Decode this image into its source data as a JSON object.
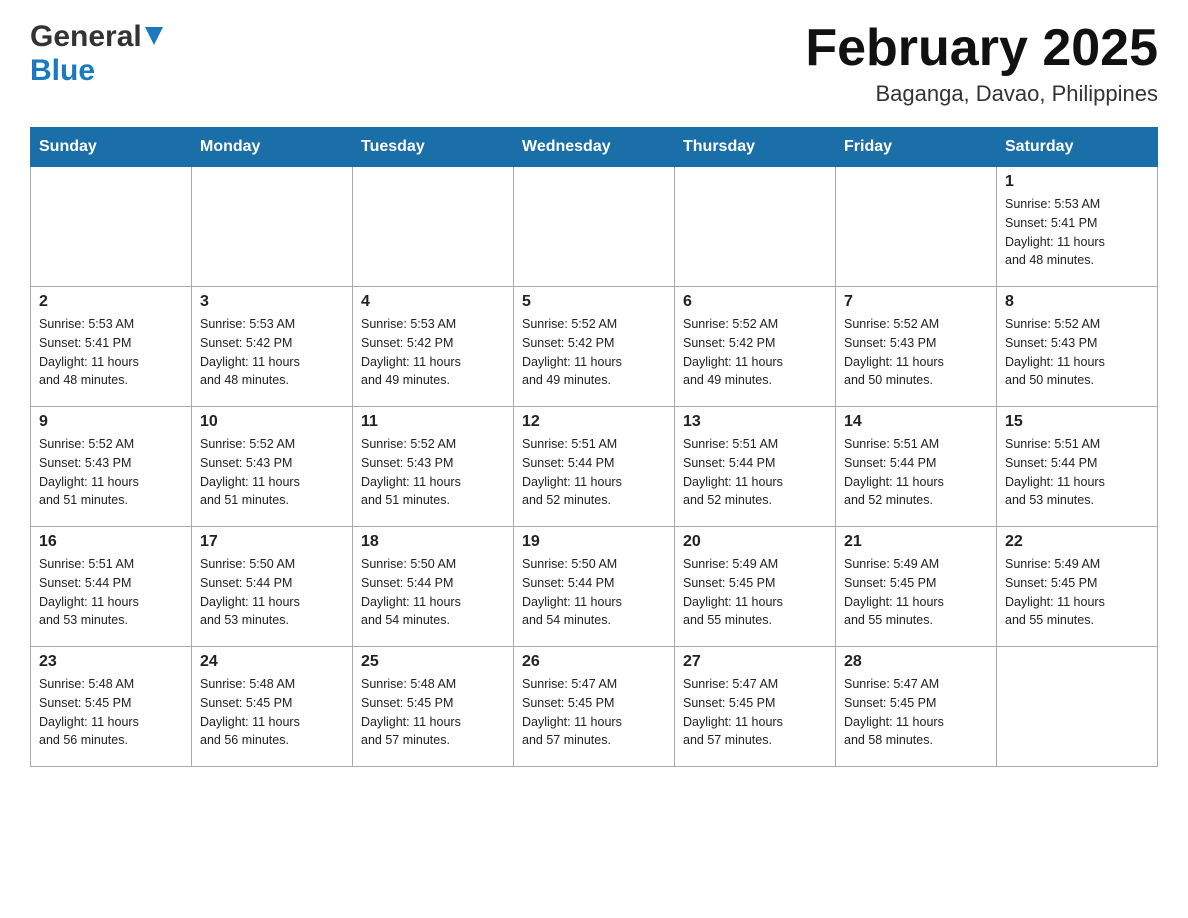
{
  "header": {
    "logo_general": "General",
    "logo_blue": "Blue",
    "month_title": "February 2025",
    "location": "Baganga, Davao, Philippines"
  },
  "calendar": {
    "days_of_week": [
      "Sunday",
      "Monday",
      "Tuesday",
      "Wednesday",
      "Thursday",
      "Friday",
      "Saturday"
    ],
    "weeks": [
      [
        {
          "day": "",
          "info": ""
        },
        {
          "day": "",
          "info": ""
        },
        {
          "day": "",
          "info": ""
        },
        {
          "day": "",
          "info": ""
        },
        {
          "day": "",
          "info": ""
        },
        {
          "day": "",
          "info": ""
        },
        {
          "day": "1",
          "info": "Sunrise: 5:53 AM\nSunset: 5:41 PM\nDaylight: 11 hours\nand 48 minutes."
        }
      ],
      [
        {
          "day": "2",
          "info": "Sunrise: 5:53 AM\nSunset: 5:41 PM\nDaylight: 11 hours\nand 48 minutes."
        },
        {
          "day": "3",
          "info": "Sunrise: 5:53 AM\nSunset: 5:42 PM\nDaylight: 11 hours\nand 48 minutes."
        },
        {
          "day": "4",
          "info": "Sunrise: 5:53 AM\nSunset: 5:42 PM\nDaylight: 11 hours\nand 49 minutes."
        },
        {
          "day": "5",
          "info": "Sunrise: 5:52 AM\nSunset: 5:42 PM\nDaylight: 11 hours\nand 49 minutes."
        },
        {
          "day": "6",
          "info": "Sunrise: 5:52 AM\nSunset: 5:42 PM\nDaylight: 11 hours\nand 49 minutes."
        },
        {
          "day": "7",
          "info": "Sunrise: 5:52 AM\nSunset: 5:43 PM\nDaylight: 11 hours\nand 50 minutes."
        },
        {
          "day": "8",
          "info": "Sunrise: 5:52 AM\nSunset: 5:43 PM\nDaylight: 11 hours\nand 50 minutes."
        }
      ],
      [
        {
          "day": "9",
          "info": "Sunrise: 5:52 AM\nSunset: 5:43 PM\nDaylight: 11 hours\nand 51 minutes."
        },
        {
          "day": "10",
          "info": "Sunrise: 5:52 AM\nSunset: 5:43 PM\nDaylight: 11 hours\nand 51 minutes."
        },
        {
          "day": "11",
          "info": "Sunrise: 5:52 AM\nSunset: 5:43 PM\nDaylight: 11 hours\nand 51 minutes."
        },
        {
          "day": "12",
          "info": "Sunrise: 5:51 AM\nSunset: 5:44 PM\nDaylight: 11 hours\nand 52 minutes."
        },
        {
          "day": "13",
          "info": "Sunrise: 5:51 AM\nSunset: 5:44 PM\nDaylight: 11 hours\nand 52 minutes."
        },
        {
          "day": "14",
          "info": "Sunrise: 5:51 AM\nSunset: 5:44 PM\nDaylight: 11 hours\nand 52 minutes."
        },
        {
          "day": "15",
          "info": "Sunrise: 5:51 AM\nSunset: 5:44 PM\nDaylight: 11 hours\nand 53 minutes."
        }
      ],
      [
        {
          "day": "16",
          "info": "Sunrise: 5:51 AM\nSunset: 5:44 PM\nDaylight: 11 hours\nand 53 minutes."
        },
        {
          "day": "17",
          "info": "Sunrise: 5:50 AM\nSunset: 5:44 PM\nDaylight: 11 hours\nand 53 minutes."
        },
        {
          "day": "18",
          "info": "Sunrise: 5:50 AM\nSunset: 5:44 PM\nDaylight: 11 hours\nand 54 minutes."
        },
        {
          "day": "19",
          "info": "Sunrise: 5:50 AM\nSunset: 5:44 PM\nDaylight: 11 hours\nand 54 minutes."
        },
        {
          "day": "20",
          "info": "Sunrise: 5:49 AM\nSunset: 5:45 PM\nDaylight: 11 hours\nand 55 minutes."
        },
        {
          "day": "21",
          "info": "Sunrise: 5:49 AM\nSunset: 5:45 PM\nDaylight: 11 hours\nand 55 minutes."
        },
        {
          "day": "22",
          "info": "Sunrise: 5:49 AM\nSunset: 5:45 PM\nDaylight: 11 hours\nand 55 minutes."
        }
      ],
      [
        {
          "day": "23",
          "info": "Sunrise: 5:48 AM\nSunset: 5:45 PM\nDaylight: 11 hours\nand 56 minutes."
        },
        {
          "day": "24",
          "info": "Sunrise: 5:48 AM\nSunset: 5:45 PM\nDaylight: 11 hours\nand 56 minutes."
        },
        {
          "day": "25",
          "info": "Sunrise: 5:48 AM\nSunset: 5:45 PM\nDaylight: 11 hours\nand 57 minutes."
        },
        {
          "day": "26",
          "info": "Sunrise: 5:47 AM\nSunset: 5:45 PM\nDaylight: 11 hours\nand 57 minutes."
        },
        {
          "day": "27",
          "info": "Sunrise: 5:47 AM\nSunset: 5:45 PM\nDaylight: 11 hours\nand 57 minutes."
        },
        {
          "day": "28",
          "info": "Sunrise: 5:47 AM\nSunset: 5:45 PM\nDaylight: 11 hours\nand 58 minutes."
        },
        {
          "day": "",
          "info": ""
        }
      ]
    ]
  }
}
